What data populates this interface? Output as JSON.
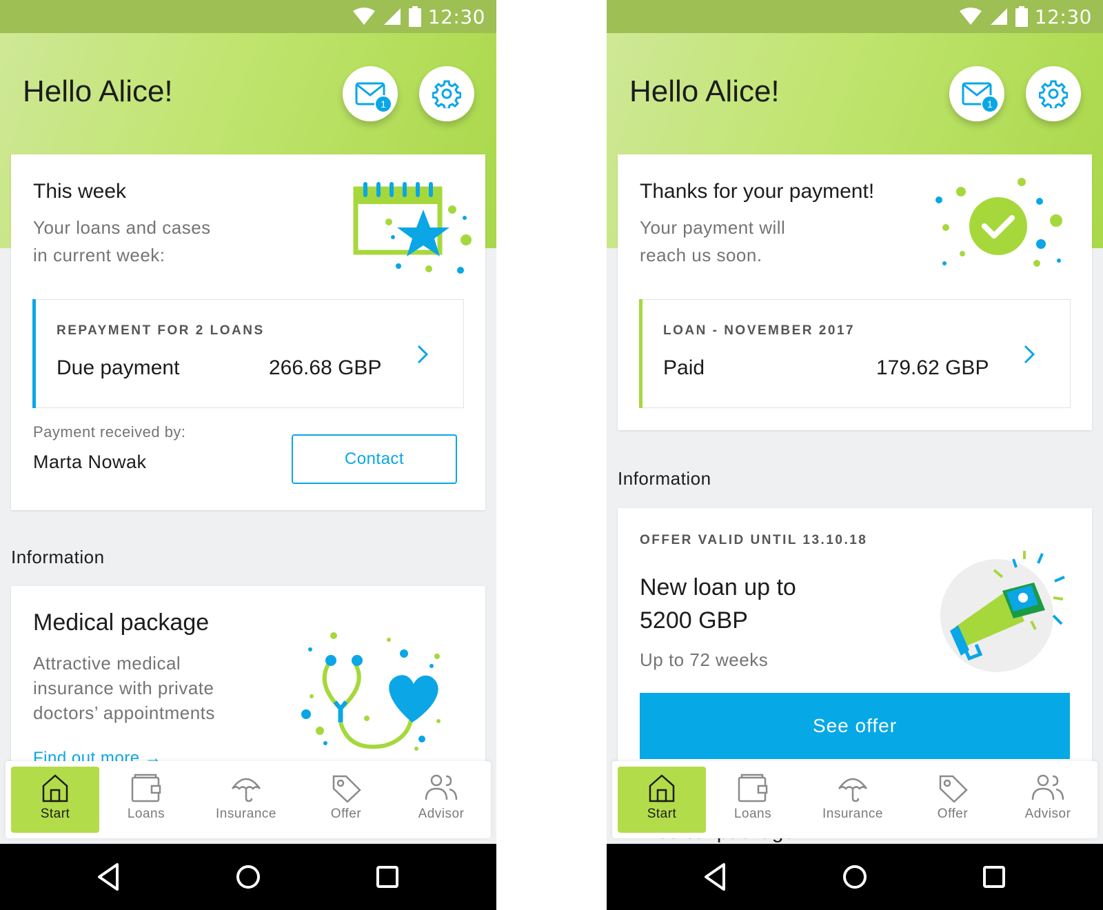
{
  "status_bar": {
    "time": "12:30"
  },
  "left": {
    "greeting": "Hello Alice!",
    "mail_badge": "1",
    "this_week": {
      "title": "This week",
      "subtitle_line1": "Your loans and cases",
      "subtitle_line2": "in current week:",
      "kicker": "REPAYMENT FOR 2 LOANS",
      "row_label": "Due payment",
      "row_amount": "266.68 GBP",
      "received_label": "Payment received by:",
      "received_name": "Marta Nowak",
      "contact_button": "Contact"
    },
    "information_title": "Information",
    "medical": {
      "title": "Medical package",
      "line1": "Attractive medical",
      "line2": "insurance with private",
      "line3": "doctors’ appointments",
      "link": "Find out more"
    }
  },
  "right": {
    "greeting": "Hello Alice!",
    "mail_badge": "1",
    "thanks": {
      "title": "Thanks for your payment!",
      "subtitle_line1": "Your payment will",
      "subtitle_line2": "reach us soon.",
      "kicker": "LOAN - NOVEMBER 2017",
      "row_label": "Paid",
      "row_amount": "179.62 GBP"
    },
    "information_title": "Information",
    "offer": {
      "kicker": "OFFER VALID UNTIL 13.10.18",
      "title_line1": "New loan up to",
      "title_line2": "5200 GBP",
      "subtitle": "Up to 72 weeks",
      "button": "See offer"
    },
    "peek_text": "Medical package"
  },
  "tabs": [
    {
      "label": "Start",
      "icon": "home-icon",
      "active": true
    },
    {
      "label": "Loans",
      "icon": "wallet-icon",
      "active": false
    },
    {
      "label": "Insurance",
      "icon": "umbrella-icon",
      "active": false
    },
    {
      "label": "Offer",
      "icon": "tag-icon",
      "active": false
    },
    {
      "label": "Advisor",
      "icon": "people-icon",
      "active": false
    }
  ],
  "colors": {
    "brand_green": "#b3dc4a",
    "accent_blue": "#0aa6e6",
    "status_bar": "#9dbf54",
    "text_dark": "#1c1c1c",
    "text_muted": "#747474"
  }
}
